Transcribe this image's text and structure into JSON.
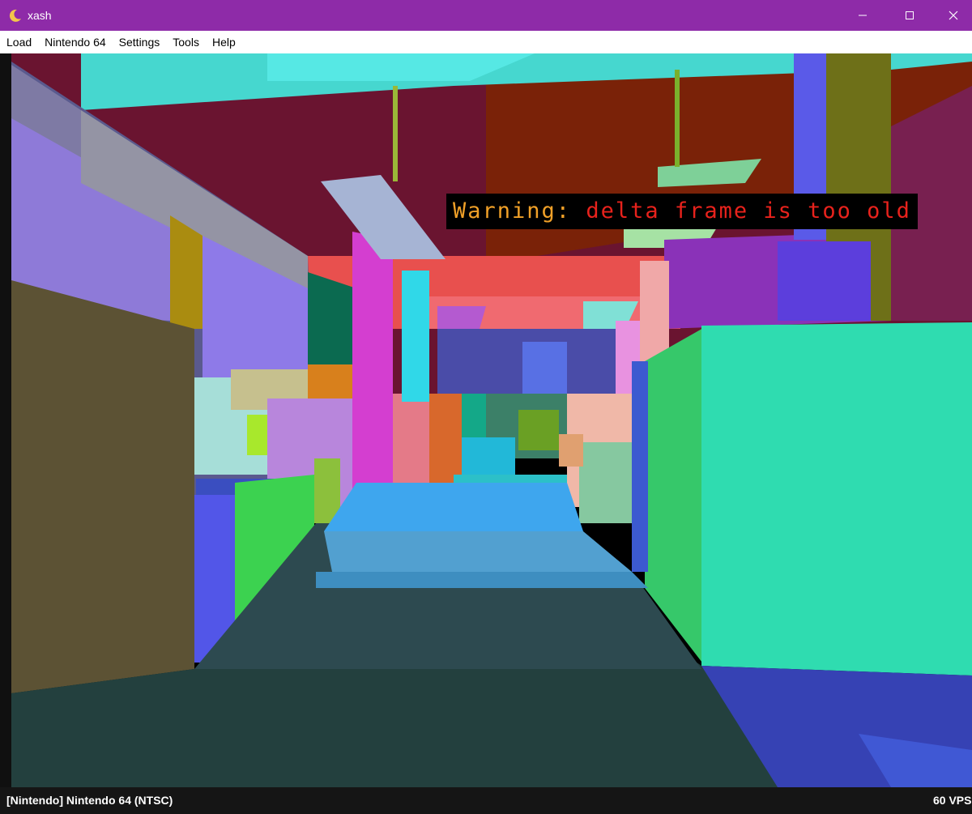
{
  "window": {
    "title": "xash",
    "title_bar_color": "#8e2ba8",
    "icon": "crescent-moon-icon",
    "controls": [
      "minimize-icon",
      "maximize-icon",
      "close-icon"
    ]
  },
  "menu": {
    "items": [
      "Load",
      "Nintendo 64",
      "Settings",
      "Tools",
      "Help"
    ]
  },
  "overlay": {
    "warning_label": "Warning:",
    "warning_message": "delta frame is too old",
    "label_color": "#f0a028",
    "message_color": "#e8221c"
  },
  "status": {
    "system": "[Nintendo] Nintendo 64 (NTSC)",
    "vps": "60 VPS"
  }
}
